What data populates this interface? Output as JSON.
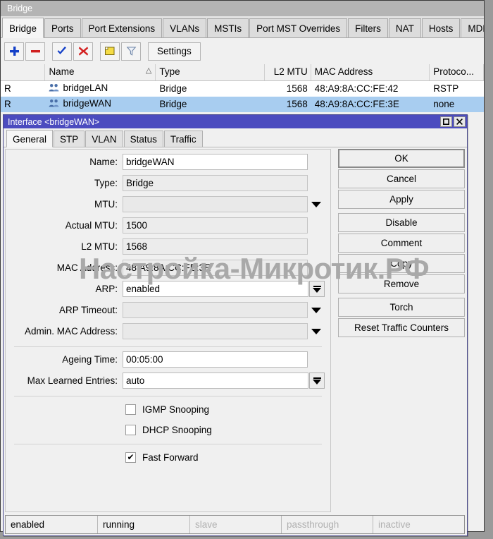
{
  "window": {
    "title": "Bridge",
    "tabs": [
      {
        "label": "Bridge",
        "selected": true
      },
      {
        "label": "Ports",
        "selected": false
      },
      {
        "label": "Port Extensions",
        "selected": false
      },
      {
        "label": "VLANs",
        "selected": false
      },
      {
        "label": "MSTIs",
        "selected": false
      },
      {
        "label": "Port MST Overrides",
        "selected": false
      },
      {
        "label": "Filters",
        "selected": false
      },
      {
        "label": "NAT",
        "selected": false
      },
      {
        "label": "Hosts",
        "selected": false
      },
      {
        "label": "MDB",
        "selected": false
      }
    ],
    "toolbar": {
      "add_icon": "plus-icon",
      "remove_icon": "minus-icon",
      "enable_icon": "check-icon",
      "disable_icon": "cross-icon",
      "comment_icon": "note-icon",
      "filter_icon": "funnel-icon",
      "settings_label": "Settings"
    },
    "table": {
      "columns": [
        "",
        "Name",
        "Type",
        "L2 MTU",
        "MAC Address",
        "Protoco..."
      ],
      "sort_indicator": "△",
      "rows": [
        {
          "flag": "R",
          "icon": "bridge-interface-icon",
          "name": "bridgeLAN",
          "type": "Bridge",
          "l2mtu": "1568",
          "mac": "48:A9:8A:CC:FE:42",
          "protocol": "RSTP",
          "selected": false
        },
        {
          "flag": "R",
          "icon": "bridge-interface-icon",
          "name": "bridgeWAN",
          "type": "Bridge",
          "l2mtu": "1568",
          "mac": "48:A9:8A:CC:FE:3E",
          "protocol": "none",
          "selected": true
        }
      ]
    }
  },
  "dialog": {
    "title": "Interface <bridgeWAN>",
    "maximize_icon": "maximize-icon",
    "close_icon": "close-icon",
    "tabs": [
      {
        "label": "General",
        "selected": true
      },
      {
        "label": "STP",
        "selected": false
      },
      {
        "label": "VLAN",
        "selected": false
      },
      {
        "label": "Status",
        "selected": false
      },
      {
        "label": "Traffic",
        "selected": false
      }
    ],
    "fields": [
      {
        "label": "Name:",
        "value": "bridgeWAN",
        "state": "editable",
        "control": "text"
      },
      {
        "label": "Type:",
        "value": "Bridge",
        "state": "readonly",
        "control": "text"
      },
      {
        "label": "MTU:",
        "value": "",
        "state": "empty",
        "control": "caret"
      },
      {
        "label": "Actual MTU:",
        "value": "1500",
        "state": "readonly",
        "control": "text"
      },
      {
        "label": "L2 MTU:",
        "value": "1568",
        "state": "readonly",
        "control": "text"
      },
      {
        "label": "MAC Address:",
        "value": "48:A9:8A:CC:FE:3E",
        "state": "readonly",
        "control": "text"
      },
      {
        "label": "ARP:",
        "value": "enabled",
        "state": "editable",
        "control": "combo"
      },
      {
        "label": "ARP Timeout:",
        "value": "",
        "state": "empty",
        "control": "caret"
      },
      {
        "label": "Admin. MAC Address:",
        "value": "",
        "state": "empty",
        "control": "caret"
      }
    ],
    "fields2": [
      {
        "label": "Ageing Time:",
        "value": "00:05:00",
        "state": "editable",
        "control": "text"
      },
      {
        "label": "Max Learned Entries:",
        "value": "auto",
        "state": "editable",
        "control": "combo"
      }
    ],
    "checkboxes": [
      {
        "label": "IGMP Snooping",
        "checked": false
      },
      {
        "label": "DHCP Snooping",
        "checked": false
      }
    ],
    "checkboxes2": [
      {
        "label": "Fast Forward",
        "checked": true
      }
    ],
    "check_glyph": "✔",
    "buttons": [
      {
        "label": "OK",
        "default": true,
        "gap": false
      },
      {
        "label": "Cancel",
        "default": false,
        "gap": false
      },
      {
        "label": "Apply",
        "default": false,
        "gap": false
      },
      {
        "label": "Disable",
        "default": false,
        "gap": true
      },
      {
        "label": "Comment",
        "default": false,
        "gap": false
      },
      {
        "label": "Copy",
        "default": false,
        "gap": false
      },
      {
        "label": "Remove",
        "default": false,
        "gap": false
      },
      {
        "label": "Torch",
        "default": false,
        "gap": true
      },
      {
        "label": "Reset Traffic Counters",
        "default": false,
        "gap": false
      }
    ],
    "status": [
      {
        "label": "enabled",
        "active": true
      },
      {
        "label": "running",
        "active": true
      },
      {
        "label": "slave",
        "active": false
      },
      {
        "label": "passthrough",
        "active": false
      },
      {
        "label": "inactive",
        "active": false
      }
    ]
  },
  "watermark": {
    "text": "Настройка-Микротик.РФ",
    "color": "#a9a9a9"
  }
}
